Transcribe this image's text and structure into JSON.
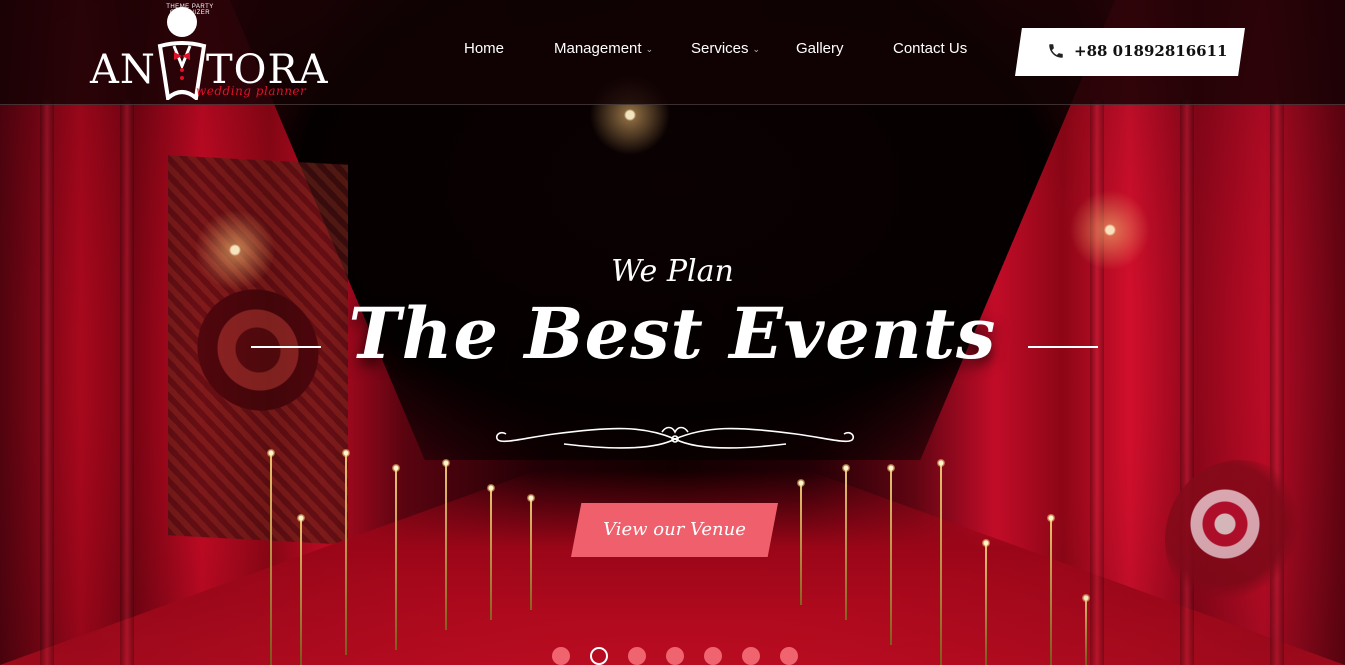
{
  "brand": {
    "name_part1": "AN",
    "name_part2": "TORA",
    "tagline": "wedding planner",
    "arc_text": "THEME PARTY ORGANIZER"
  },
  "nav": {
    "items": [
      {
        "label": "Home",
        "has_dropdown": false
      },
      {
        "label": "Management",
        "has_dropdown": true
      },
      {
        "label": "Services",
        "has_dropdown": true
      },
      {
        "label": "Gallery",
        "has_dropdown": false
      },
      {
        "label": "Contact Us",
        "has_dropdown": false
      }
    ]
  },
  "contact": {
    "phone": "+88 01892816611",
    "icon": "phone-icon"
  },
  "hero": {
    "subtitle": "We Plan",
    "title": "The Best Events",
    "cta_label": "View our Venue"
  },
  "slider": {
    "total": 7,
    "active_index": 1
  },
  "colors": {
    "accent": "#f0606c",
    "header_bg": "#120204",
    "brand_red": "#e0102a"
  }
}
